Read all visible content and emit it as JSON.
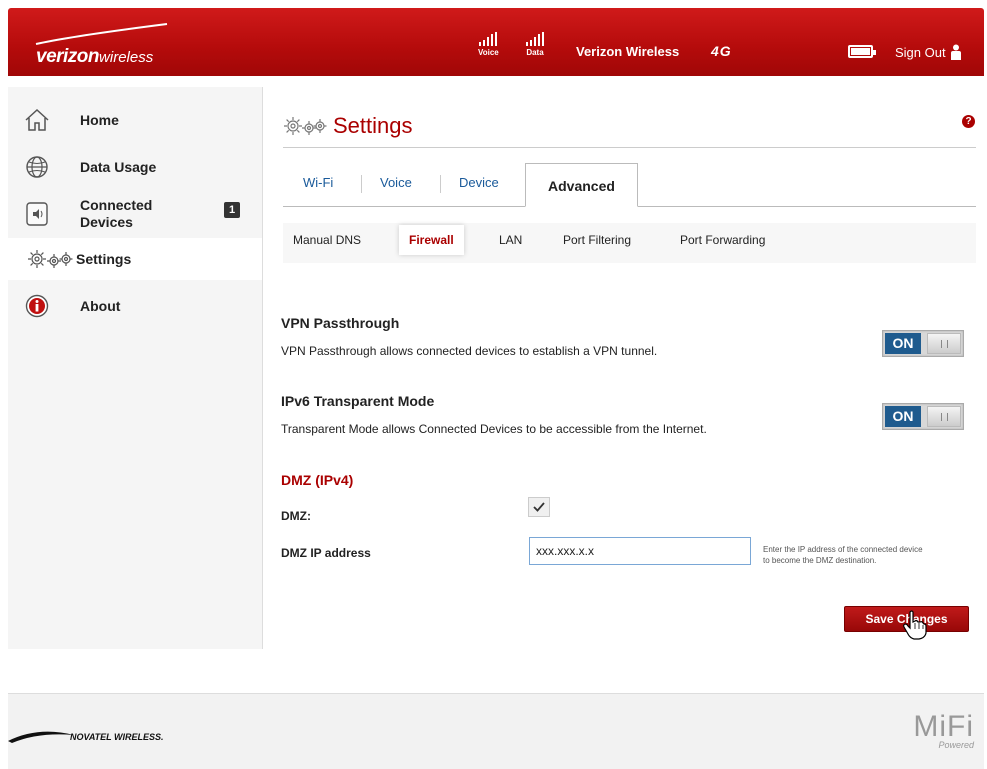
{
  "header": {
    "logo_main": "verizon",
    "logo_sub": "wireless",
    "signal_voice_label": "Voice",
    "signal_data_label": "Data",
    "carrier": "Verizon Wireless",
    "network": "4G",
    "signout_label": "Sign Out",
    "brand_color": "#c00d0d"
  },
  "sidebar": {
    "items": [
      {
        "label": "Home",
        "icon": "home-icon"
      },
      {
        "label": "Data Usage",
        "icon": "globe-icon"
      },
      {
        "label": "Connected",
        "label2": "Devices",
        "icon": "speaker-icon",
        "badge": "1"
      },
      {
        "label": "Settings",
        "icon": "gears-icon",
        "active": true
      },
      {
        "label": "About",
        "icon": "info-icon"
      }
    ]
  },
  "main": {
    "title": "Settings",
    "help": "?",
    "tabs": [
      "Wi-Fi",
      "Voice",
      "Device",
      "Advanced"
    ],
    "active_tab": "Advanced",
    "subtabs": [
      "Manual DNS",
      "Firewall",
      "LAN",
      "Port Filtering",
      "Port Forwarding"
    ],
    "active_subtab": "Firewall",
    "vpn": {
      "title": "VPN Passthrough",
      "desc": "VPN Passthrough allows connected devices to establish a VPN tunnel.",
      "state": "ON"
    },
    "ipv6": {
      "title": "IPv6 Transparent Mode",
      "desc": "Transparent Mode allows Connected Devices to be accessible from the Internet.",
      "state": "ON"
    },
    "dmz": {
      "heading": "DMZ (IPv4)",
      "dmz_label": "DMZ:",
      "dmz_checked": true,
      "ip_label": "DMZ IP address",
      "ip_value": "xxx.xxx.x.x",
      "hint_line1": "Enter the IP address of the connected device",
      "hint_line2": "to become the DMZ destination."
    },
    "save_label": "Save Changes"
  },
  "footer": {
    "novatel": "NOVATEL WIRELESS.",
    "mifi": "MiFi",
    "mifi_sub": "Powered"
  }
}
